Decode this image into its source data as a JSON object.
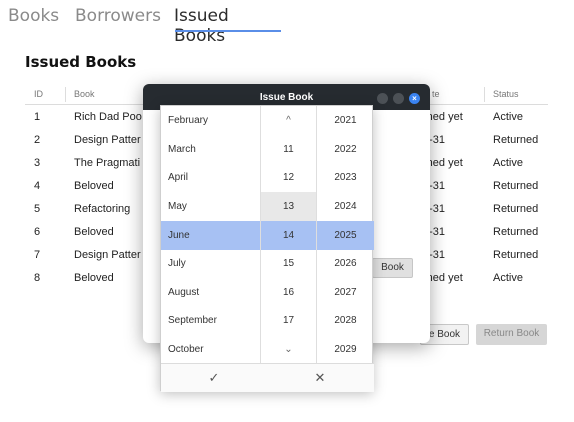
{
  "tabs": [
    {
      "label": "Books"
    },
    {
      "label": "Borrowers"
    },
    {
      "label": "Issued Books"
    }
  ],
  "page_title": "Issued Books",
  "table": {
    "headers": [
      "ID",
      "Book",
      "te",
      "Status"
    ],
    "rows": [
      {
        "id": "1",
        "book": "Rich Dad Poo",
        "date": "rned yet",
        "status": "Active"
      },
      {
        "id": "2",
        "book": "Design Patter",
        "date": "5-31",
        "status": "Returned"
      },
      {
        "id": "3",
        "book": "The Pragmati",
        "date": "rned yet",
        "status": "Active"
      },
      {
        "id": "4",
        "book": "Beloved",
        "date": "5-31",
        "status": "Returned"
      },
      {
        "id": "5",
        "book": "Refactoring",
        "date": "5-31",
        "status": "Returned"
      },
      {
        "id": "6",
        "book": "Beloved",
        "date": "5-31",
        "status": "Returned"
      },
      {
        "id": "7",
        "book": "Design Patter",
        "date": "5-31",
        "status": "Returned"
      },
      {
        "id": "8",
        "book": "Beloved",
        "date": "rned yet",
        "status": "Active"
      }
    ]
  },
  "buttons": {
    "issue_book": "e Book",
    "return_book": "Return Book"
  },
  "dialog": {
    "title": "Issue Book",
    "inner_button": "Book",
    "close_glyph": "×"
  },
  "date_picker": {
    "months": [
      "February",
      "March",
      "April",
      "May",
      "June",
      "July",
      "August",
      "September",
      "October"
    ],
    "days": [
      "^",
      "11",
      "12",
      "13",
      "14",
      "15",
      "16",
      "17",
      "⌄"
    ],
    "years": [
      "2021",
      "2022",
      "2023",
      "2024",
      "2025",
      "2026",
      "2027",
      "2028",
      "2029"
    ],
    "selected": {
      "month": "June",
      "day": "14",
      "year": "2025"
    },
    "confirm_glyph": "✓",
    "cancel_glyph": "✕"
  },
  "colors": {
    "accent": "#5a8ee8",
    "selection": "#a7c1f3",
    "dialog_titlebar": "#262b30",
    "close_button": "#3a83f1"
  }
}
